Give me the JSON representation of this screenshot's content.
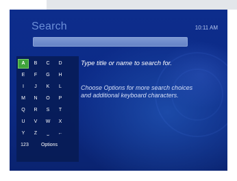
{
  "header": {
    "title": "Search",
    "clock": "10:11 AM"
  },
  "search": {
    "query": ""
  },
  "keyboard": {
    "keys": [
      {
        "label": "A",
        "selected": true
      },
      {
        "label": "B"
      },
      {
        "label": "C"
      },
      {
        "label": "D"
      },
      {
        "label": "E"
      },
      {
        "label": "F"
      },
      {
        "label": "G"
      },
      {
        "label": "H"
      },
      {
        "label": "I"
      },
      {
        "label": "J"
      },
      {
        "label": "K"
      },
      {
        "label": "L"
      },
      {
        "label": "M"
      },
      {
        "label": "N"
      },
      {
        "label": "O"
      },
      {
        "label": "P"
      },
      {
        "label": "Q"
      },
      {
        "label": "R"
      },
      {
        "label": "S"
      },
      {
        "label": "T"
      },
      {
        "label": "U"
      },
      {
        "label": "V"
      },
      {
        "label": "W"
      },
      {
        "label": "X"
      },
      {
        "label": "Y"
      },
      {
        "label": "Z"
      },
      {
        "label": "⎵",
        "name": "space-key"
      },
      {
        "label": "←",
        "name": "backspace-key"
      },
      {
        "label": "123",
        "name": "numbers-key"
      },
      {
        "label": "Options",
        "name": "options-key"
      }
    ]
  },
  "hints": {
    "primary": "Type title or name to search for.",
    "secondary": "Choose Options for more search choices and additional keyboard characters."
  },
  "colors": {
    "background": "#0c2a86",
    "title": "#6c8fd8",
    "search_field": "#7089c9",
    "selected_key": "#3fa33c"
  }
}
